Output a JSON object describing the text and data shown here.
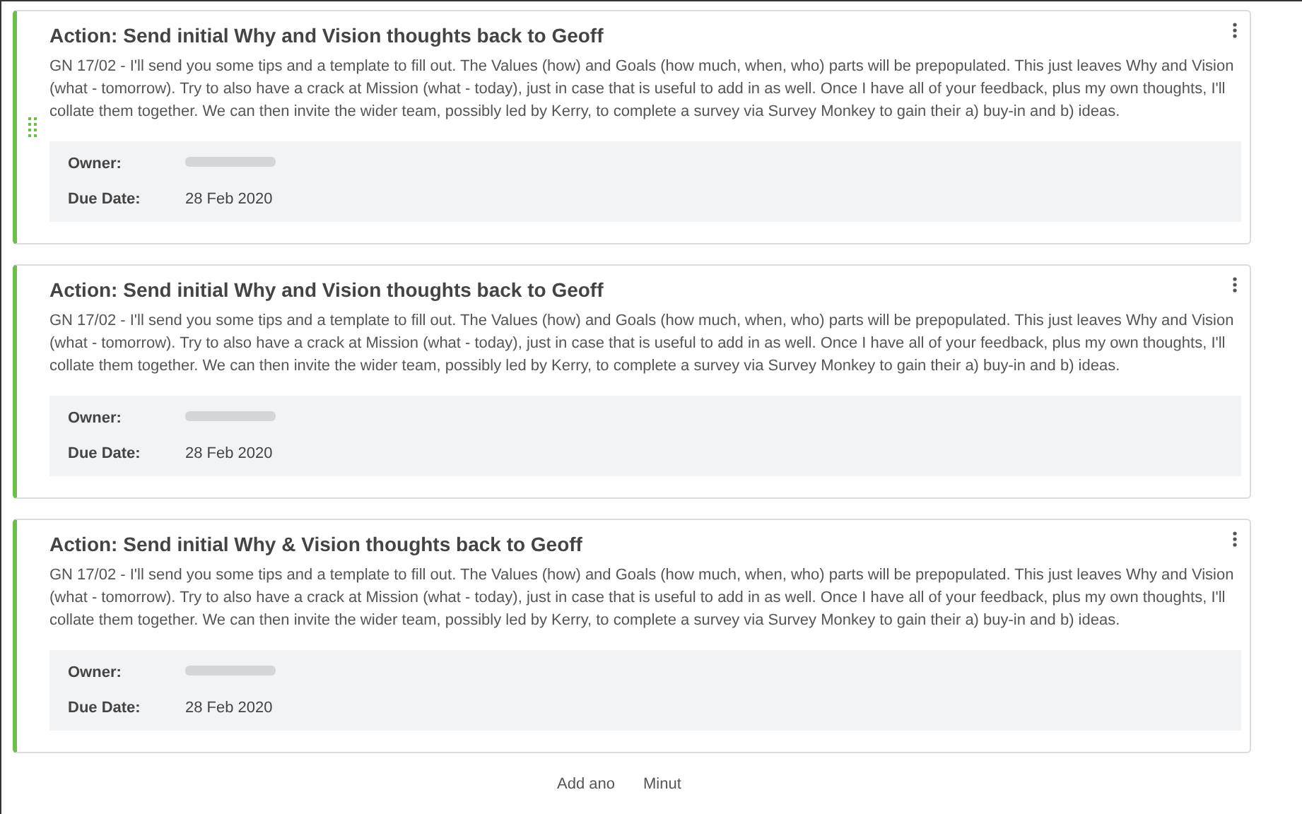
{
  "actions": [
    {
      "title": "Action: Send initial Why and Vision thoughts back to Geoff",
      "drag_handle": true,
      "body": "GN 17/02 - I'll send you some tips and a template to fill out. The Values (how) and Goals (how much, when, who) parts will be prepopulated. This just leaves Why and Vision (what - tomorrow). Try to also have a crack at Mission (what - today), just in case that is useful to add in as well. Once I have all of your feedback, plus my own thoughts, I'll collate them together. We can then invite the wider team, possibly led by Kerry, to complete a survey via Survey Monkey to gain their a) buy-in and b) ideas.",
      "owner_label": "Owner:",
      "due_label": "Due Date:",
      "due": "28 Feb 2020"
    },
    {
      "title": "Action: Send initial Why and Vision thoughts back to Geoff",
      "drag_handle": false,
      "body": "GN 17/02 - I'll send you some tips and a template to fill out. The Values (how) and Goals (how much, when, who) parts will be prepopulated. This just leaves Why and Vision (what - tomorrow). Try to also have a crack at Mission (what - today), just in case that is useful to add in as well. Once I have all of your feedback, plus my own thoughts, I'll collate them together. We can then invite the wider team, possibly led by Kerry, to complete a survey via Survey Monkey to gain their a) buy-in and b) ideas.",
      "owner_label": "Owner:",
      "due_label": "Due Date:",
      "due": "28 Feb 2020"
    },
    {
      "title": "Action: Send initial Why & Vision thoughts back to Geoff",
      "drag_handle": false,
      "body": "GN 17/02 - I'll send you some tips and a template to fill out. The Values (how) and Goals (how much, when, who) parts will be prepopulated. This just leaves Why and Vision (what - tomorrow). Try to also have a crack at Mission (what - today), just in case that is useful to add in as well. Once I have all of your feedback, plus my own thoughts, I'll collate them together. We can then invite the wider team, possibly led by Kerry, to complete a survey via Survey Monkey to gain their a) buy-in and b) ideas.",
      "owner_label": "Owner:",
      "due_label": "Due Date:",
      "due": "28 Feb 2020"
    }
  ],
  "footer_link_parts": [
    "Add ano",
    "Minut"
  ]
}
